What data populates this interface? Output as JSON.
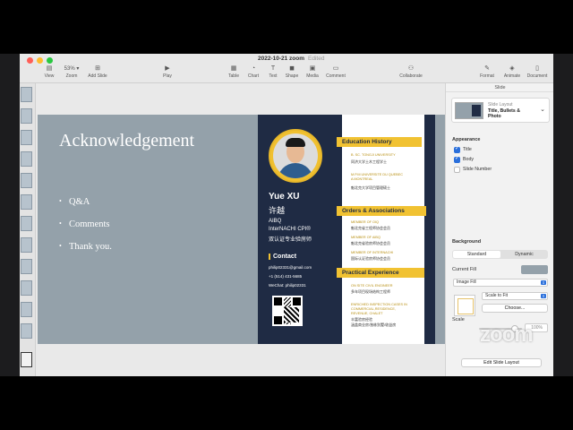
{
  "window": {
    "title": "2022-10-21 zoom",
    "status": "Edited"
  },
  "toolbar": {
    "view": "View",
    "zoom_value": "53%",
    "zoom": "Zoom",
    "add_slide": "Add Slide",
    "play": "Play",
    "table": "Table",
    "chart": "Chart",
    "text": "Text",
    "shape": "Shape",
    "media": "Media",
    "comment": "Comment",
    "collaborate": "Collaborate",
    "format": "Format",
    "animate": "Animate",
    "document": "Document"
  },
  "slide": {
    "title": "Acknowledgement",
    "bullets": [
      "Q&A",
      "Comments",
      "Thank you."
    ],
    "background": "#94a1aa"
  },
  "resume": {
    "name": "Yue XU",
    "name_cn": "许越",
    "lines": [
      "AIBQ",
      "InterNACHI CPI®",
      "双认证专业验房师"
    ],
    "contact_heading": "Contact",
    "contact_lines": [
      "philip02331@gmail.com",
      "+1 (514) 431-5685",
      "WeChat: philip02331"
    ],
    "education": {
      "heading": "Education History",
      "items": [
        {
          "en": "B. SC. TONGJI UNIVERSITY",
          "cn": "同济大学土木工程学士"
        },
        {
          "en": "M.P.M UNIVERSITE DU QUEBEC",
          "en2": "A MONTREAL",
          "cn": "魁北克大学项目管理硕士"
        }
      ]
    },
    "orders": {
      "heading": "Orders & Associations",
      "items": [
        {
          "en": "MEMBER OF OIQ",
          "cn": "魁北克省工程师协会会员"
        },
        {
          "en": "MEMBER OF AIBQ",
          "cn": "魁北克省验房师协会会员"
        },
        {
          "en": "MEMBER OF INTERNACHI",
          "cn": "国际认证验房师协会会员"
        }
      ]
    },
    "practical": {
      "heading": "Practical Experience",
      "items": [
        {
          "en": "ON SITE CIVIL ENGINEER",
          "cn": "多年项目现场结构工程师"
        },
        {
          "en": "ENRICHED INSPECTION CASES IN",
          "en2": "COMMERCIAL,RESIDENCE,",
          "en3": "REVENUE, CHALET",
          "cn": "丰富验房经验",
          "cn2": "涵盖商业房/独栋别墅/收益房"
        }
      ]
    },
    "accent": "#f1c232",
    "navy": "#1f2b44"
  },
  "inspector": {
    "tab": "Slide",
    "layout_kicker": "Slide Layout",
    "layout_name_1": "Title, Bullets &",
    "layout_name_2": "Photo",
    "appearance": "Appearance",
    "title_chk": "Title",
    "body_chk": "Body",
    "slide_number_chk": "Slide Number",
    "background": "Background",
    "standard": "Standard",
    "dynamic": "Dynamic",
    "current_fill": "Current Fill",
    "image_fill": "Image Fill",
    "scale_to_fit": "Scale to Fit",
    "choose": "Choose...",
    "scale": "Scale",
    "scale_value": "100%",
    "edit_layout": "Edit Slide Layout"
  },
  "overlay": {
    "logo": "zoom"
  },
  "icons": [
    "view-icon",
    "zoom-icon",
    "add-slide-icon",
    "play-icon",
    "table-icon",
    "chart-icon",
    "text-icon",
    "shape-icon",
    "media-icon",
    "comment-icon",
    "collaborate-icon",
    "format-icon",
    "animate-icon",
    "document-icon"
  ]
}
